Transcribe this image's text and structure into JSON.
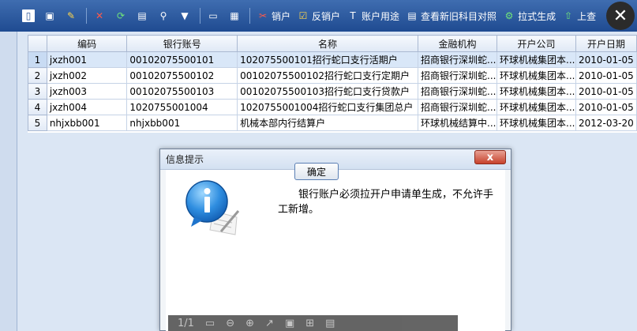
{
  "toolbar": {
    "items": [
      {
        "icon": "new-icon",
        "label": ""
      },
      {
        "icon": "save-icon",
        "label": ""
      },
      {
        "icon": "brush-icon",
        "label": ""
      },
      {
        "icon": "delete-icon",
        "label": ""
      },
      {
        "icon": "refresh-icon",
        "label": ""
      },
      {
        "icon": "clipboard-icon",
        "label": ""
      },
      {
        "icon": "filter-icon",
        "label": ""
      },
      {
        "icon": "dropdown-icon",
        "label": ""
      },
      {
        "icon": "print-icon",
        "label": ""
      },
      {
        "icon": "print-preview-icon",
        "label": ""
      },
      {
        "icon": "cancel-account-icon",
        "label": "销户"
      },
      {
        "icon": "undo-cancel-icon",
        "label": "反销户"
      },
      {
        "icon": "purpose-icon",
        "label": "账户用途"
      },
      {
        "icon": "compare-icon",
        "label": "查看新旧科目对照"
      },
      {
        "icon": "generate-icon",
        "label": "拉式生成"
      },
      {
        "icon": "upload-icon",
        "label": "上查"
      }
    ],
    "close_glyph": "✕"
  },
  "grid": {
    "columns": [
      "",
      "编码",
      "银行账号",
      "名称",
      "金融机构",
      "开户公司",
      "开户日期"
    ],
    "rows": [
      [
        "1",
        "jxzh001",
        "00102075500101",
        "102075500101招行蛇口支行活期户",
        "招商银行深圳蛇...",
        "环球机械集团本...",
        "2010-01-05"
      ],
      [
        "2",
        "jxzh002",
        "00102075500102",
        "00102075500102招行蛇口支行定期户",
        "招商银行深圳蛇...",
        "环球机械集团本...",
        "2010-01-05"
      ],
      [
        "3",
        "jxzh003",
        "00102075500103",
        "00102075500103招行蛇口支行贷款户",
        "招商银行深圳蛇...",
        "环球机械集团本...",
        "2010-01-05"
      ],
      [
        "4",
        "jxzh004",
        "1020755001004",
        "1020755001004招行蛇口支行集团总户",
        "招商银行深圳蛇...",
        "环球机械集团本...",
        "2010-01-05"
      ],
      [
        "5",
        "nhjxbb001",
        "nhjxbb001",
        "机械本部内行结算户",
        "环球机械结算中...",
        "环球机械集团本...",
        "2012-03-20"
      ]
    ]
  },
  "dialog": {
    "title": "信息提示",
    "close_glyph": "x",
    "message": "银行账户必须拉开户申请单生成，不允许手工新增。",
    "ok_label": "确定"
  },
  "nav": {
    "page": "1/1"
  }
}
